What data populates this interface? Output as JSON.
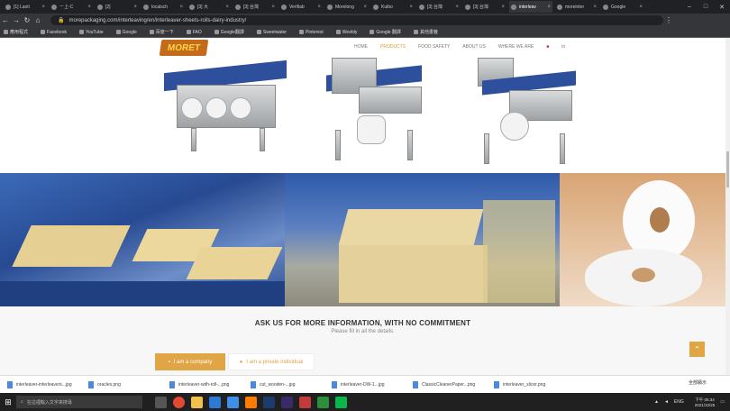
{
  "tabs": [
    "[1] Laoti",
    "ㄧ上-C",
    "[2]",
    "localsch",
    "[3] 大",
    "[3] 台灣",
    "Verifiab",
    "Morelong",
    "Kuibo",
    "[3] 台灣",
    "[3] 台灣",
    "interleav",
    "moreinter",
    "Google"
  ],
  "url": "morepackaging.com/interleaving/en/interleaver-sheets-rolls-dairy-industry/",
  "bookmarks": [
    "應用程式",
    "Facebook",
    "YouTube",
    "Google",
    "百度一下",
    "FAO",
    "Google翻譯",
    "Sweetwater",
    "Pinterest",
    "Weebly",
    "Google 翻譯",
    "其他書籤"
  ],
  "nav": {
    "home": "HOME",
    "products": "PRODUCTS",
    "food_safety": "FOOD SAFETY",
    "about": "ABOUT US",
    "where": "WHERE WE ARE",
    "social": "in"
  },
  "logo_text": "MORET",
  "cta": {
    "title": "ASK US FOR MORE INFORMATION, WITH NO COMMITMENT",
    "subtitle": "Please fill in all the details.",
    "btn_company": "I am a company",
    "btn_private": "I am a private individual"
  },
  "downloads": [
    "interleaver-interleavers...jpg",
    "oracles.png",
    "interleaver-with-roll-...png",
    "cut_wooden-...jpg",
    "interleaver-DW-1...jpg",
    "ClassicCleanerPaper...png",
    "interleaver_slicer.png"
  ],
  "downloads_show_all": "全部顯示",
  "taskbar": {
    "search_placeholder": "在這裡輸入文字來搜尋",
    "time": "下午 05:34",
    "date": "2021/10/25",
    "lang": "ENG"
  }
}
